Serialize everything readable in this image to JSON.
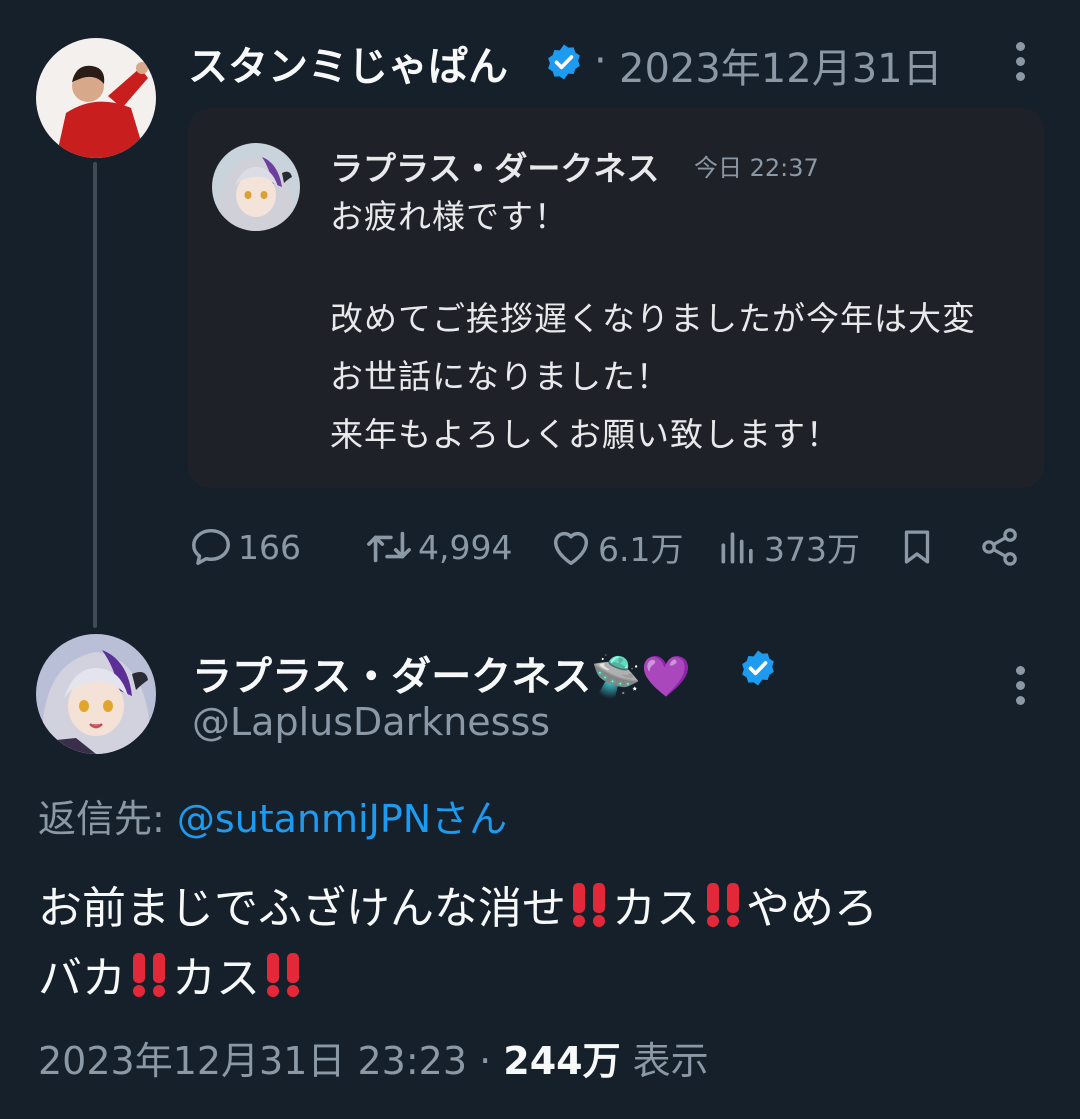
{
  "parent_tweet": {
    "author_name": "スタンミじゃぱん",
    "separator": "·",
    "date": "2023年12月31日"
  },
  "quoted_tweet": {
    "author_name": "ラプラス・ダークネス",
    "time": "今日 22:37",
    "lines": [
      "お疲れ様です！",
      "",
      "改めてご挨拶遅くなりましたが今年は大変",
      "お世話になりました！",
      "来年もよろしくお願い致します！"
    ]
  },
  "actions": {
    "replies": "166",
    "retweets": "4,994",
    "likes": "6.1万",
    "views": "373万"
  },
  "reply_tweet": {
    "author_name": "ラプラス・ダークネス",
    "emojis": "🛸💜",
    "handle": "@LaplusDarknesss",
    "reply_to_label": "返信先: ",
    "reply_to_link": "@sutanmiJPNさん",
    "body": {
      "seg1": "お前まじでふざけんな消せ",
      "seg2": "カス",
      "seg3": "やめろ",
      "seg4": "バカ",
      "seg5": "カス"
    },
    "footer_date": "2023年12月31日 23:23 · ",
    "footer_views": "244万",
    "footer_views_suffix": " 表示"
  },
  "colors": {
    "background": "#15202b",
    "card": "#1e2127",
    "muted": "#8b98a5",
    "link": "#1d9bf0",
    "verified": "#1d9bf0",
    "emphasis_red": "#e3283a"
  }
}
